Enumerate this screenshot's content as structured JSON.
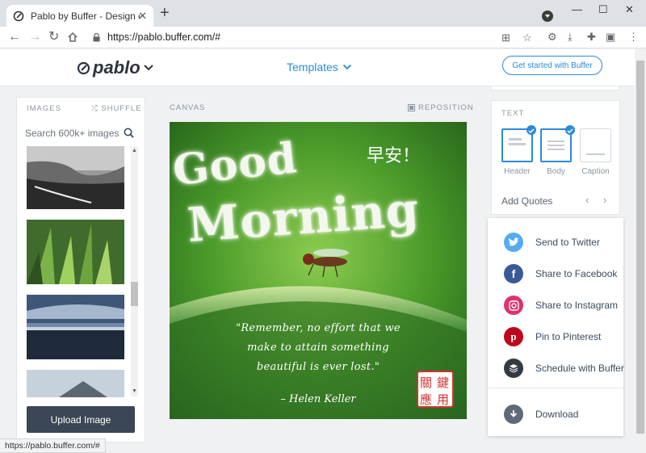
{
  "browser": {
    "tab_title": "Pablo by Buffer - Design engag",
    "url": "https://pablo.buffer.com/#",
    "status_url": "https://pablo.buffer.com/#"
  },
  "header": {
    "logo_text": "pablo",
    "templates_label": "Templates",
    "cta_label": "Get started with Buffer"
  },
  "images_panel": {
    "title": "IMAGES",
    "shuffle_label": "SHUFFLE",
    "search_placeholder": "Search 600k+ images",
    "upload_label": "Upload Image"
  },
  "canvas": {
    "label": "CANVAS",
    "reposition_label": "REPOSITION",
    "headline_line1": "Good",
    "headline_line2": "Morning",
    "greeting": "早安！",
    "quote_lines": [
      "\"Remember, no effort that we",
      "make to attain something",
      "beautiful is ever lost.\""
    ],
    "author": "– Helen Keller",
    "seal_chars": [
      "關",
      "鍵",
      "應",
      "用"
    ]
  },
  "text_panel": {
    "title": "TEXT",
    "styles": [
      {
        "name": "Header",
        "active": true
      },
      {
        "name": "Body",
        "active": true
      },
      {
        "name": "Caption",
        "active": false
      }
    ],
    "add_quotes_label": "Add Quotes"
  },
  "share": {
    "items": [
      {
        "label": "Send to Twitter",
        "icon": "twitter-icon",
        "color": "#55acee"
      },
      {
        "label": "Share to Facebook",
        "icon": "facebook-icon",
        "color": "#3b5998"
      },
      {
        "label": "Share to Instagram",
        "icon": "instagram-icon",
        "color": "#e1306c"
      },
      {
        "label": "Pin to Pinterest",
        "icon": "pinterest-icon",
        "color": "#bd081c"
      },
      {
        "label": "Schedule with Buffer",
        "icon": "buffer-icon",
        "color": "#323b43"
      }
    ],
    "download_label": "Download",
    "download_color": "#5f6a78"
  },
  "colors": {
    "accent": "#2b8ad9",
    "upload_button": "#3b4656"
  }
}
